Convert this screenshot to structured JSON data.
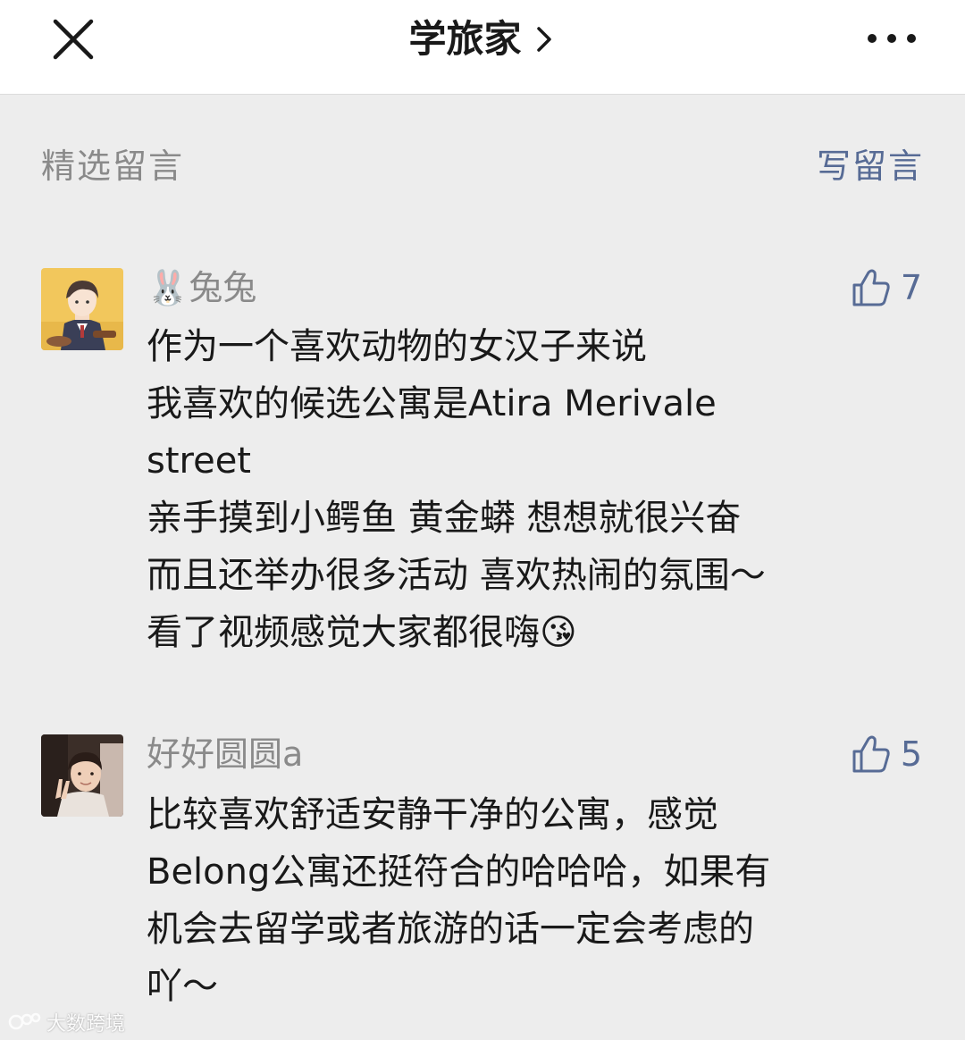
{
  "header": {
    "title": "学旅家",
    "close_icon": "close-icon",
    "more_icon": "more-dots-icon",
    "chevron_icon": "chevron-right-icon"
  },
  "section": {
    "title": "精选留言",
    "write_comment_label": "写留言"
  },
  "comments": [
    {
      "avatar": "avatar-anime-boy",
      "nickname": "🐰兔兔",
      "likes": "7",
      "lines": [
        "作为一个喜欢动物的女汉子来说",
        "我喜欢的候选公寓是Atira Merivale",
        "street",
        "亲手摸到小鳄鱼 黄金蟒 想想就很兴奋",
        "而且还举办很多活动 喜欢热闹的氛围～",
        "看了视频感觉大家都很嗨😘"
      ]
    },
    {
      "avatar": "avatar-photo",
      "nickname": "好好圆圆a",
      "likes": "5",
      "lines": [
        "比较喜欢舒适安静干净的公寓，感觉",
        "Belong公寓还挺符合的哈哈哈，如果有",
        "机会去留学或者旅游的话一定会考虑的",
        "吖～"
      ]
    }
  ],
  "watermark": {
    "text": "大数跨境"
  },
  "colors": {
    "link": "#576b95",
    "meta_gray": "#8a8a8a",
    "background": "#ededed",
    "text": "#191919"
  }
}
